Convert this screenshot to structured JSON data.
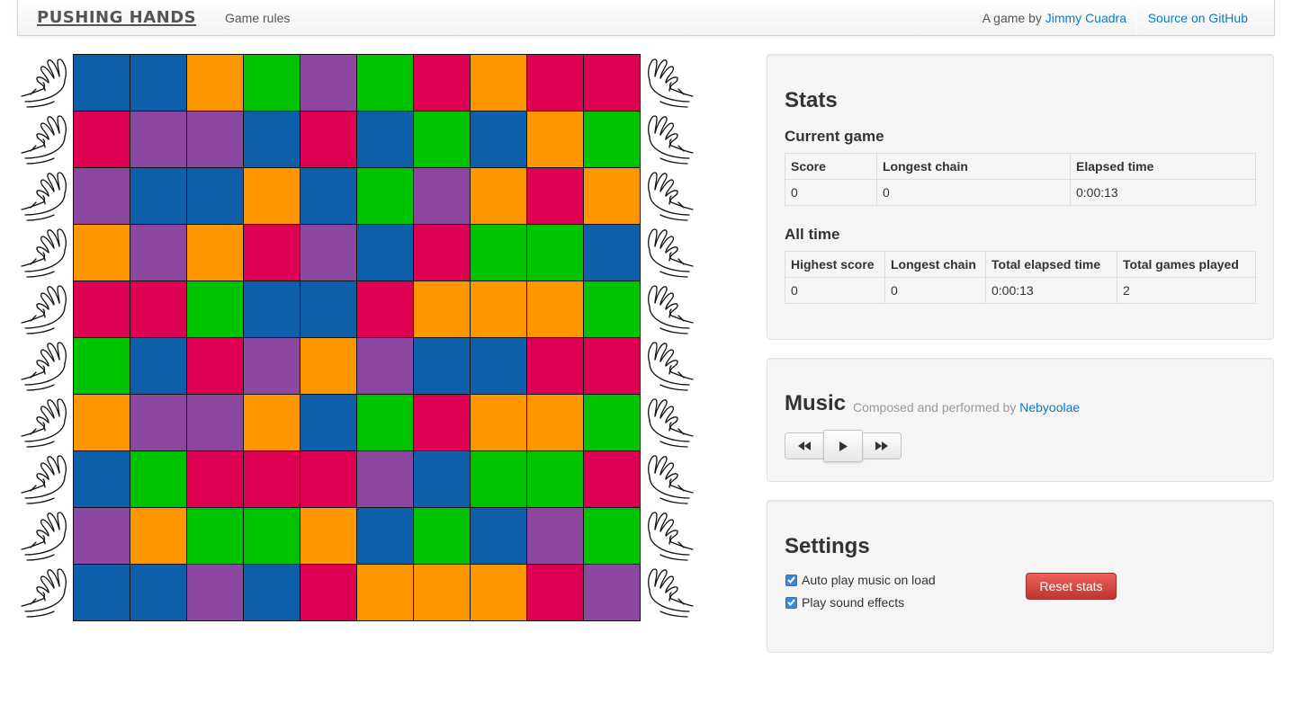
{
  "nav": {
    "brand": "PUSHING HANDS",
    "game_rules": "Game rules",
    "by_text": "A game by ",
    "author": "Jimmy Cuadra",
    "source": "Source on GitHub"
  },
  "colors": {
    "blue": "#0c5fa8",
    "orange": "#fe9600",
    "green": "#00c300",
    "purple": "#8c48a0",
    "red": "#de0052"
  },
  "board": {
    "rows": [
      [
        "blue",
        "blue",
        "orange",
        "green",
        "purple",
        "green",
        "red",
        "orange",
        "red",
        "red"
      ],
      [
        "red",
        "purple",
        "purple",
        "blue",
        "red",
        "blue",
        "green",
        "blue",
        "orange",
        "green"
      ],
      [
        "purple",
        "blue",
        "blue",
        "orange",
        "blue",
        "green",
        "purple",
        "orange",
        "red",
        "orange"
      ],
      [
        "orange",
        "purple",
        "orange",
        "red",
        "purple",
        "blue",
        "red",
        "green",
        "green",
        "blue"
      ],
      [
        "red",
        "red",
        "green",
        "blue",
        "blue",
        "red",
        "orange",
        "orange",
        "orange",
        "green"
      ],
      [
        "green",
        "blue",
        "red",
        "purple",
        "orange",
        "purple",
        "blue",
        "blue",
        "red",
        "red"
      ],
      [
        "orange",
        "purple",
        "purple",
        "orange",
        "blue",
        "green",
        "red",
        "orange",
        "orange",
        "green"
      ],
      [
        "blue",
        "green",
        "red",
        "red",
        "red",
        "purple",
        "blue",
        "green",
        "green",
        "red"
      ],
      [
        "purple",
        "orange",
        "green",
        "green",
        "orange",
        "blue",
        "green",
        "blue",
        "purple",
        "green"
      ],
      [
        "blue",
        "blue",
        "purple",
        "blue",
        "red",
        "orange",
        "orange",
        "orange",
        "red",
        "purple"
      ]
    ]
  },
  "stats": {
    "title": "Stats",
    "current": {
      "heading": "Current game",
      "headers": [
        "Score",
        "Longest chain",
        "Elapsed time"
      ],
      "values": [
        "0",
        "0",
        "0:00:13"
      ]
    },
    "alltime": {
      "heading": "All time",
      "headers": [
        "Highest score",
        "Longest chain",
        "Total elapsed time",
        "Total games played"
      ],
      "values": [
        "0",
        "0",
        "0:00:13",
        "2"
      ]
    }
  },
  "music": {
    "title": "Music",
    "subtitle": "Composed and performed by ",
    "composer": "Nebyoolae",
    "buttons": [
      "rewind-icon",
      "play-icon",
      "fast-forward-icon"
    ]
  },
  "settings": {
    "title": "Settings",
    "autoplay_label": "Auto play music on load",
    "autoplay_checked": true,
    "sfx_label": "Play sound effects",
    "sfx_checked": true,
    "reset_label": "Reset stats"
  }
}
